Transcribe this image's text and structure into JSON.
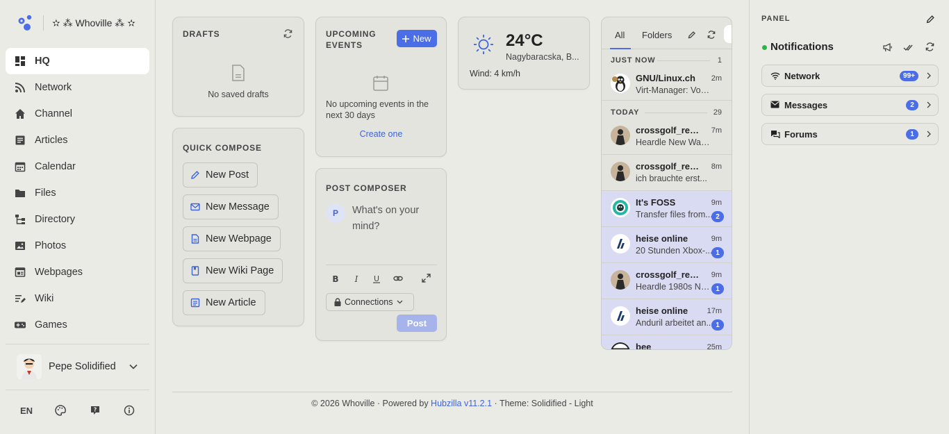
{
  "site": {
    "name": "✫ ⁂ Whoville ⁂ ✫"
  },
  "nav": [
    {
      "label": "HQ",
      "icon": "dashboard-icon",
      "active": true
    },
    {
      "label": "Network",
      "icon": "rss-icon"
    },
    {
      "label": "Channel",
      "icon": "home-icon"
    },
    {
      "label": "Articles",
      "icon": "article-icon"
    },
    {
      "label": "Calendar",
      "icon": "calendar-icon"
    },
    {
      "label": "Files",
      "icon": "folder-icon"
    },
    {
      "label": "Directory",
      "icon": "directory-icon"
    },
    {
      "label": "Photos",
      "icon": "image-icon"
    },
    {
      "label": "Webpages",
      "icon": "webpage-icon"
    },
    {
      "label": "Wiki",
      "icon": "wiki-icon"
    },
    {
      "label": "Games",
      "icon": "gamepad-icon"
    }
  ],
  "user": {
    "name": "Pepe Solidified"
  },
  "sidebar_footer": {
    "language": "EN"
  },
  "drafts": {
    "title": "DRAFTS",
    "empty_text": "No saved drafts"
  },
  "quick_compose": {
    "title": "QUICK COMPOSE",
    "buttons": [
      {
        "label": "New Post",
        "icon": "pencil-icon"
      },
      {
        "label": "New Message",
        "icon": "mail-icon"
      },
      {
        "label": "New Webpage",
        "icon": "file-icon"
      },
      {
        "label": "New Wiki Page",
        "icon": "book-icon"
      },
      {
        "label": "New Article",
        "icon": "article-icon"
      }
    ]
  },
  "events": {
    "title": "UPCOMING EVENTS",
    "new_label": "New",
    "empty_text": "No upcoming events in the next 30 days",
    "create_label": "Create one"
  },
  "composer": {
    "title": "POST COMPOSER",
    "avatar_letter": "P",
    "placeholder": "What's on your mind?",
    "permission_label": "Connections",
    "post_label": "Post"
  },
  "weather": {
    "temperature": "24°C",
    "location": "Nagybaracska, B...",
    "wind": "Wind: 4 km/h"
  },
  "feed": {
    "tabs": [
      "All",
      "Folders"
    ],
    "sections": [
      {
        "label": "JUST NOW",
        "count": "1"
      },
      {
        "label": "TODAY",
        "count": "29"
      }
    ],
    "items": [
      {
        "name": "GNU/Linux.ch",
        "time": "2m",
        "preview": "Virt-Manager: Vom...",
        "badge": "",
        "unread": false
      },
      {
        "name": "crossgolf_reb...",
        "time": "7m",
        "preview": "Heardle New Wave...",
        "badge": "",
        "unread": false
      },
      {
        "name": "crossgolf_reb...",
        "time": "8m",
        "preview": "ich brauchte erst...",
        "badge": "",
        "unread": false
      },
      {
        "name": "It's FOSS",
        "time": "9m",
        "preview": "Transfer files from...",
        "badge": "2",
        "unread": true
      },
      {
        "name": "heise online",
        "time": "9m",
        "preview": "20 Stunden Xbox-...",
        "badge": "1",
        "unread": true
      },
      {
        "name": "crossgolf_reb...",
        "time": "9m",
        "preview": "Heardle 1980s No. 1",
        "badge": "1",
        "unread": true
      },
      {
        "name": "heise online",
        "time": "17m",
        "preview": "Anduril arbeitet an...",
        "badge": "1",
        "unread": true
      },
      {
        "name": "bee",
        "time": "25m",
        "preview": "",
        "badge": "",
        "unread": true
      }
    ]
  },
  "footer": {
    "prefix": "© 2026 Whoville · Powered by ",
    "link": "Hubzilla v11.2.1",
    "suffix": " · Theme: Solidified - Light"
  },
  "panel": {
    "title": "PANEL",
    "notifications_title": "Notifications",
    "cards": [
      {
        "label": "Network",
        "badge": "99+",
        "icon": "wifi-icon"
      },
      {
        "label": "Messages",
        "badge": "2",
        "icon": "envelope-icon"
      },
      {
        "label": "Forums",
        "badge": "1",
        "icon": "chat-icon"
      }
    ]
  },
  "colors": {
    "accent": "#4b6de6",
    "online": "#2db34a",
    "unread_bg": "#d9dbf2"
  }
}
